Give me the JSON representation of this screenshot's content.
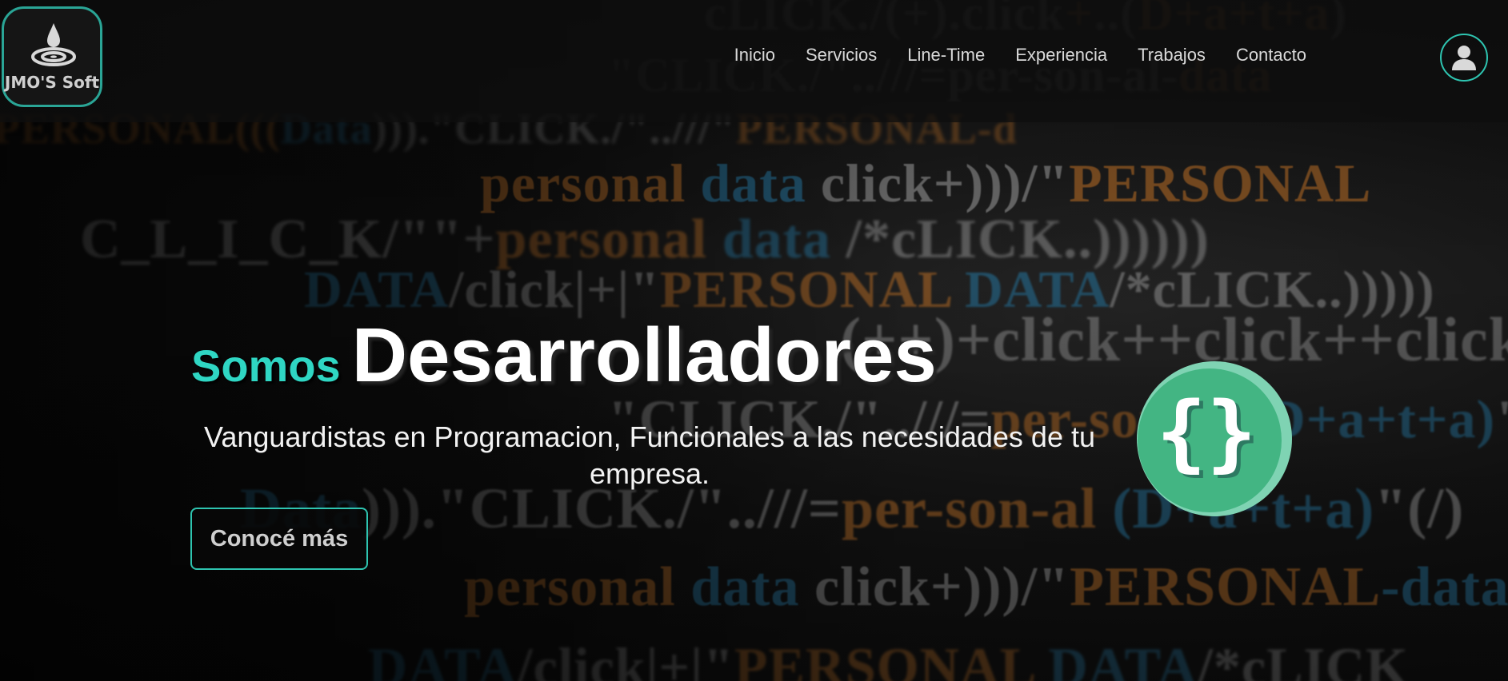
{
  "header": {
    "logo_text": "JMO'S Soft",
    "nav": [
      "Inicio",
      "Servicios",
      "Line-Time",
      "Experiencia",
      "Trabajos",
      "Contacto"
    ],
    "user_icon": "user-icon"
  },
  "hero": {
    "title_prefix": "Somos",
    "title_main": "Desarrolladores",
    "subtitle": "Vanguardistas en Programacion, Funcionales a las necesidades de tu empresa.",
    "cta_label": "Conocé más",
    "graphic_icon": "curly-braces-icon"
  },
  "background": {
    "lines": [
      {
        "segments": [
          {
            "t": "w",
            "s": "cLICK./(+).click"
          },
          {
            "t": "o",
            "s": "+"
          },
          {
            "t": "w",
            "s": "..("
          },
          {
            "t": "o",
            "s": "D+a+t+a"
          },
          {
            "t": "w",
            "s": ")"
          }
        ]
      },
      {
        "segments": [
          {
            "t": "w",
            "s": "\"CLICK./\"..///=per-son-al-"
          },
          {
            "t": "o",
            "s": "data"
          }
        ]
      },
      {
        "segments": [
          {
            "t": "o",
            "s": "=PERSONAL((("
          },
          {
            "t": "b",
            "s": "Data"
          },
          {
            "t": "w",
            "s": "))).\"CLICK./\"..///\""
          },
          {
            "t": "o",
            "s": "PERSONAL-d"
          }
        ]
      },
      {
        "segments": [
          {
            "t": "o",
            "s": "personal "
          },
          {
            "t": "b",
            "s": "data "
          },
          {
            "t": "w",
            "s": "click+)))/\""
          },
          {
            "t": "o",
            "s": "PERSONAL"
          }
        ]
      },
      {
        "segments": [
          {
            "t": "w",
            "s": "C_L_I_C_K/\"\"+"
          },
          {
            "t": "o",
            "s": "personal "
          },
          {
            "t": "b",
            "s": "data "
          },
          {
            "t": "w",
            "s": "/*cLICK..))))))"
          }
        ]
      },
      {
        "segments": [
          {
            "t": "b",
            "s": "DATA"
          },
          {
            "t": "w",
            "s": "/click|+|\""
          },
          {
            "t": "o",
            "s": "PERSONAL "
          },
          {
            "t": "b",
            "s": "DATA"
          },
          {
            "t": "w",
            "s": "/*cLICK..)))))"
          }
        ]
      },
      {
        "segments": [
          {
            "t": "w",
            "s": "(++)+click++click++click++click++~"
          }
        ]
      },
      {
        "segments": [
          {
            "t": "w",
            "s": "\"CLICK./\"..///="
          },
          {
            "t": "o",
            "s": "per-son-al "
          },
          {
            "t": "b",
            "s": "(D+a+t+a)"
          },
          {
            "t": "w",
            "s": "\""
          }
        ]
      },
      {
        "segments": [
          {
            "t": "b",
            "s": "Data"
          },
          {
            "t": "w",
            "s": "))).\"CLICK./\"..///="
          },
          {
            "t": "o",
            "s": "per-son-al "
          },
          {
            "t": "b",
            "s": "(D+a+t+a)"
          },
          {
            "t": "w",
            "s": "\"(/)"
          }
        ]
      },
      {
        "segments": [
          {
            "t": "o",
            "s": "personal "
          },
          {
            "t": "b",
            "s": "data "
          },
          {
            "t": "w",
            "s": "click+)))/\""
          },
          {
            "t": "o",
            "s": "PERSONAL"
          },
          {
            "t": "b",
            "s": "-data"
          }
        ]
      },
      {
        "segments": [
          {
            "t": "b",
            "s": "DATA"
          },
          {
            "t": "w",
            "s": "/click|+|\""
          },
          {
            "t": "o",
            "s": "PERSONAL "
          },
          {
            "t": "b",
            "s": "DATA"
          },
          {
            "t": "w",
            "s": "/*cLICK"
          }
        ]
      }
    ]
  }
}
